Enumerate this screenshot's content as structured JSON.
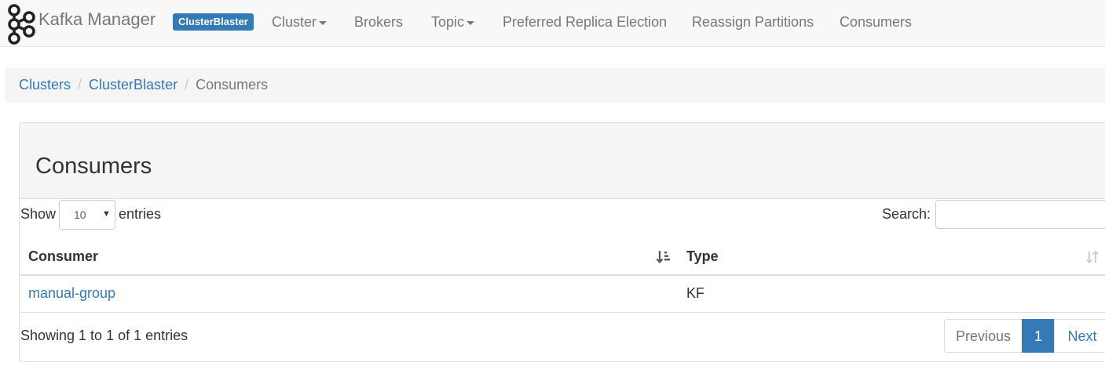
{
  "navbar": {
    "brand": "Kafka Manager",
    "cluster_badge": "ClusterBlaster",
    "items": [
      {
        "label": "Cluster",
        "dropdown": true
      },
      {
        "label": "Brokers",
        "dropdown": false
      },
      {
        "label": "Topic",
        "dropdown": true
      },
      {
        "label": "Preferred Replica Election",
        "dropdown": false
      },
      {
        "label": "Reassign Partitions",
        "dropdown": false
      },
      {
        "label": "Consumers",
        "dropdown": false
      }
    ]
  },
  "breadcrumb": {
    "items": [
      "Clusters",
      "ClusterBlaster",
      "Consumers"
    ],
    "separator": "/"
  },
  "panel": {
    "title": "Consumers"
  },
  "table_controls": {
    "show_label": "Show",
    "entries_label": "entries",
    "page_length": "10",
    "page_length_arrow": "▼",
    "search_label": "Search:",
    "search_value": ""
  },
  "table": {
    "columns": [
      "Consumer",
      "Type"
    ],
    "rows": [
      {
        "consumer": "manual-group",
        "type": "KF"
      }
    ]
  },
  "footer": {
    "info": "Showing 1 to 1 of 1 entries",
    "pagination": {
      "previous": "Previous",
      "current": "1",
      "next": "Next"
    }
  },
  "colors": {
    "link": "#337ab7",
    "navbar_bg": "#f8f8f8",
    "muted_text": "#777777"
  }
}
